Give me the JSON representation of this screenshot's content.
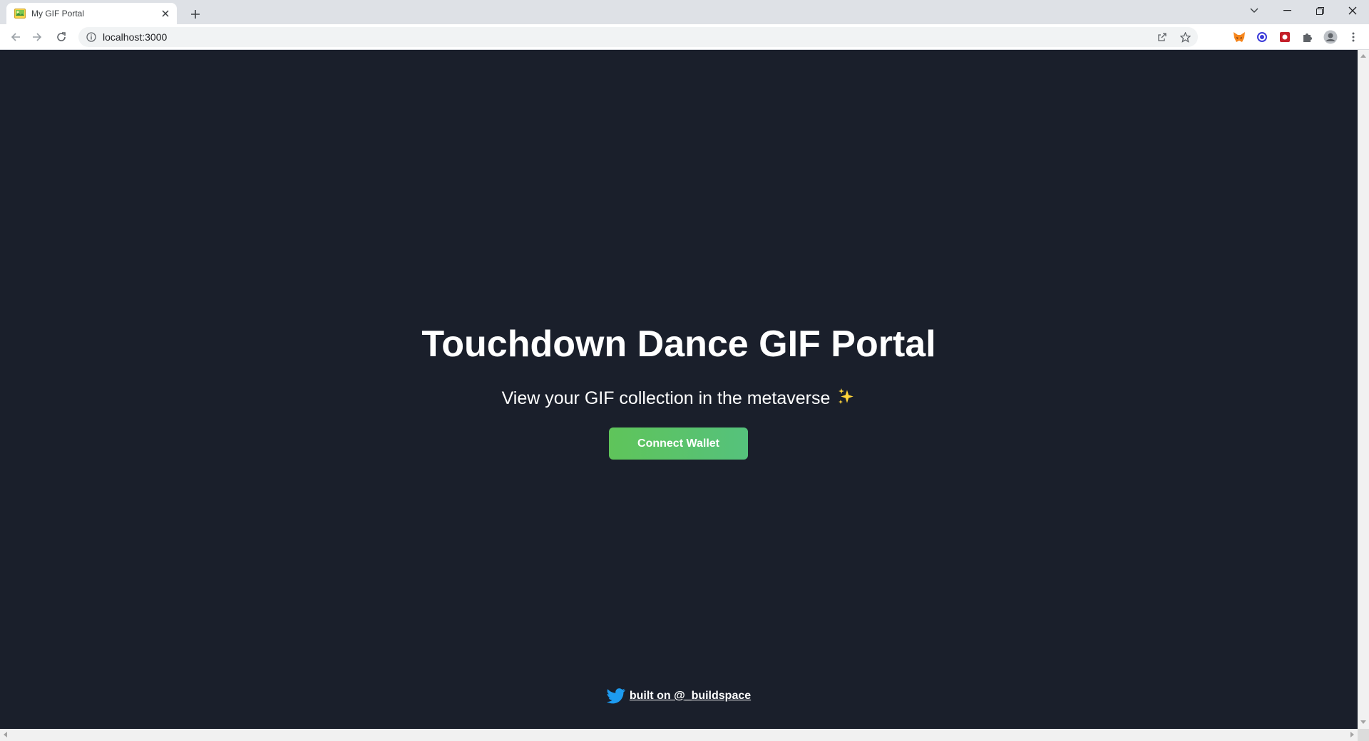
{
  "browser": {
    "tab_title": "My GIF Portal",
    "url": "localhost:3000"
  },
  "page": {
    "header": "Touchdown Dance GIF Portal",
    "subtext": "View your GIF collection in the metaverse",
    "connect_button": "Connect Wallet",
    "footer_link": "built on @_buildspace"
  },
  "colors": {
    "background": "#1a1f2b",
    "button_gradient_start": "#5fc45a",
    "button_gradient_end": "#4bbf9e",
    "twitter_blue": "#1d9bf0"
  },
  "icons": {
    "sparkle": "sparkles-emoji",
    "footer": "twitter-icon"
  }
}
